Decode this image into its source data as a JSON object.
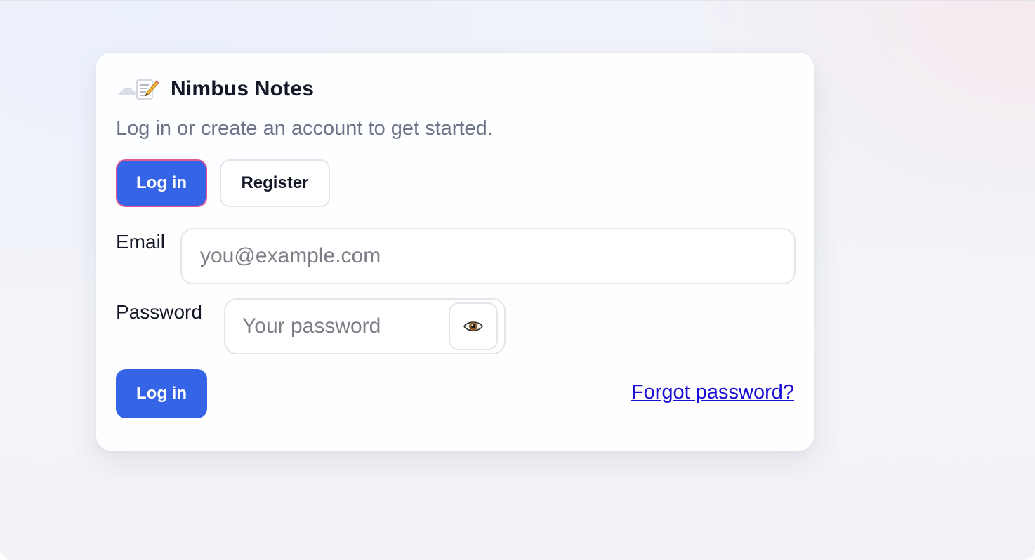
{
  "brand": {
    "logo_icons": [
      "cloud-icon",
      "memo-icon"
    ],
    "title": "Nimbus Notes"
  },
  "subtitle": "Log in or create an account to get started.",
  "mode_tabs": {
    "login_label": "Log in",
    "register_label": "Register",
    "active": "login"
  },
  "form": {
    "email": {
      "label": "Email",
      "placeholder": "you@example.com",
      "value": ""
    },
    "password": {
      "label": "Password",
      "placeholder": "Your password",
      "value": "",
      "toggle_icon": "eye-icon"
    },
    "submit_label": "Log in",
    "forgot_link": "Forgot password?"
  },
  "colors": {
    "accent": "#3565e6",
    "focus_ring": "#e2568f",
    "link": "#1a0dd6",
    "muted_text": "#6b7387"
  }
}
